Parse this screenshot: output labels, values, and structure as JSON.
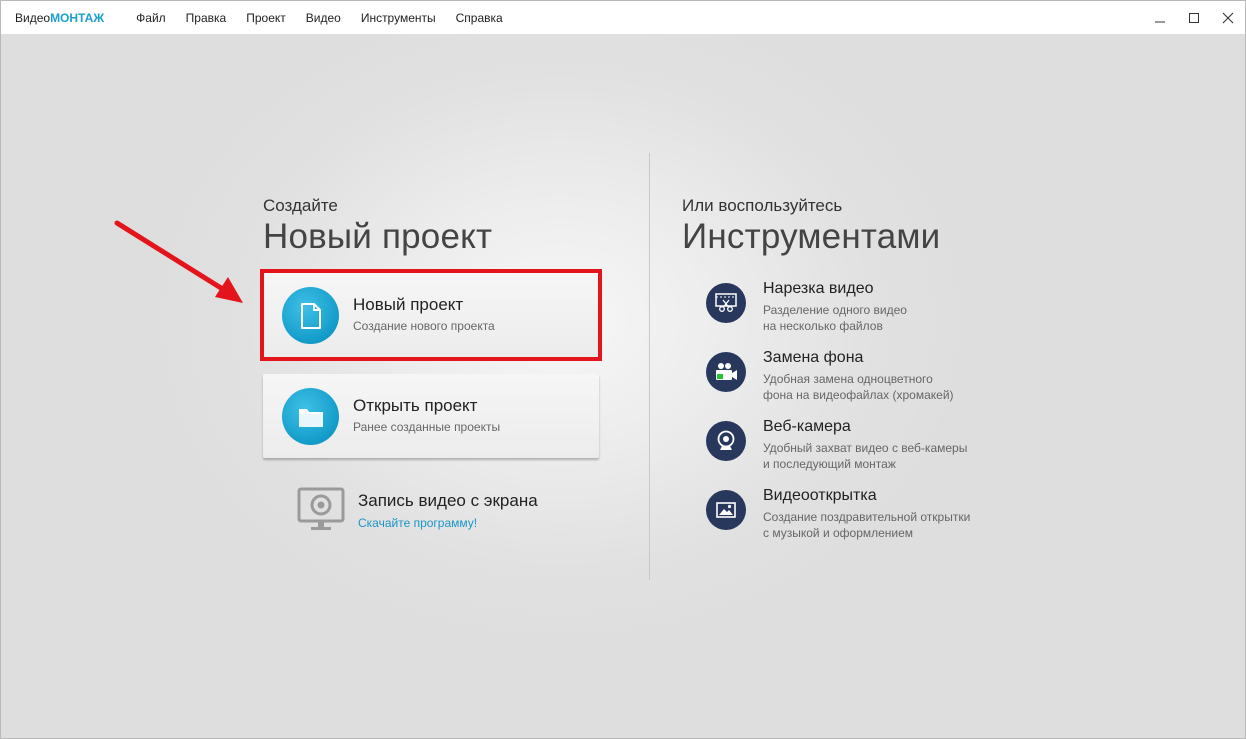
{
  "app": {
    "logo_prefix": "Видео",
    "logo_brand": "МОНТАЖ",
    "brand_color": "#1aa0cf"
  },
  "menu": [
    "Файл",
    "Правка",
    "Проект",
    "Видео",
    "Инструменты",
    "Справка"
  ],
  "window_controls": {
    "minimize_icon": "minimize-icon",
    "maximize_icon": "maximize-icon",
    "close_icon": "close-icon"
  },
  "create": {
    "subtitle": "Создайте",
    "title": "Новый проект"
  },
  "cards": [
    {
      "title": "Новый проект",
      "subtitle": "Создание нового проекта",
      "icon": "file-icon"
    },
    {
      "title": "Открыть проект",
      "subtitle": "Ранее созданные проекты",
      "icon": "folder-icon"
    }
  ],
  "record": {
    "title": "Запись видео с экрана",
    "link": "Скачайте программу!",
    "icon": "monitor-webcam-icon"
  },
  "tools_section": {
    "subtitle": "Или воспользуйтесь",
    "title": "Инструментами"
  },
  "tools": [
    {
      "title": "Нарезка видео",
      "desc1": "Разделение одного видео",
      "desc2": "на несколько файлов",
      "icon": "scissors-film-icon"
    },
    {
      "title": "Замена фона",
      "desc1": "Удобная замена одноцветного",
      "desc2": "фона на видеофайлах (хромакей)",
      "icon": "chromakey-camera-icon"
    },
    {
      "title": "Веб-камера",
      "desc1": "Удобный захват видео с веб-камеры",
      "desc2": "и последующий монтаж",
      "icon": "webcam-icon"
    },
    {
      "title": "Видеооткрытка",
      "desc1": "Создание поздравительной открытки",
      "desc2": "с музыкой и оформлением",
      "icon": "picture-icon"
    }
  ],
  "colors": {
    "accent": "#139cc9",
    "tool_icon_bg": "#28375c",
    "highlight": "#e3141c",
    "link": "#1a96c8"
  }
}
